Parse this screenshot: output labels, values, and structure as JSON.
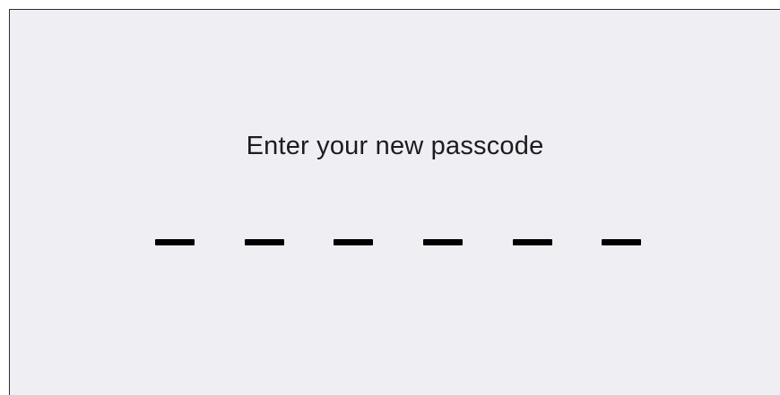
{
  "screen": {
    "prompt": "Enter your new passcode",
    "passcode": {
      "length": 6,
      "entered_digits": 0,
      "slots": [
        "",
        "",
        "",
        "",
        "",
        ""
      ]
    }
  }
}
